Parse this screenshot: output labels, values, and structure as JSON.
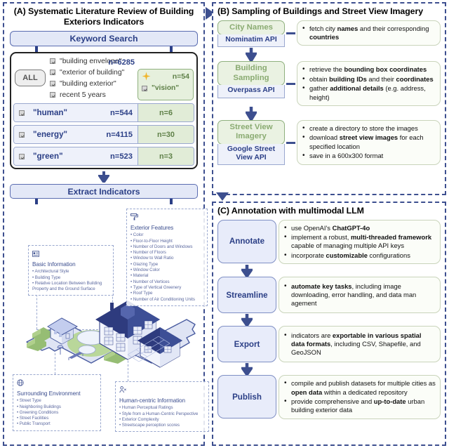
{
  "panels": {
    "a": {
      "title": "(A) Systematic Literature Review of Building Exteriors Indicators",
      "keyword_search_label": "Keyword Search",
      "all_button": "ALL",
      "all_terms": [
        "\"building envelope\"",
        "\"exterior of building\"",
        "\"building exterior\"",
        "recent 5 years"
      ],
      "all_n": "n=6285",
      "vision": {
        "n": "n=54",
        "term": "\"vision\"",
        "icon": "sparkle-star-icon"
      },
      "rows": [
        {
          "term": "\"human\"",
          "n": "n=544",
          "vision_n": "n=6"
        },
        {
          "term": "\"energy\"",
          "n": "n=4115",
          "vision_n": "n=30"
        },
        {
          "term": "\"green\"",
          "n": "n=523",
          "vision_n": "n=3"
        }
      ],
      "extract_label": "Extract Indicators",
      "indicator_groups": [
        {
          "title": "Basic Information",
          "icon": "id-card-icon",
          "items": [
            "Architectural Style",
            "Building Type",
            "Relative Location Between Building",
            "Property and the Ground Surface"
          ]
        },
        {
          "title": "Exterior Features",
          "icon": "paint-roller-icon",
          "items": [
            "Color",
            "Floor-to-Floor Height",
            "Number of Doors and Windows",
            "Number of Floors",
            "Window to Wall Ratio",
            "Glazing Type",
            "Window Color",
            "Material",
            "Number of Vertices",
            "Type of Vertical Greenery",
            "Roof Type",
            "Number of Air Conditioning Units"
          ]
        },
        {
          "title": "Surrounding Environment",
          "icon": "globe-icon",
          "items": [
            "Street Type",
            "Neighboring Buildings",
            "Greening Conditions",
            "Street Facilities",
            "Public Transport"
          ]
        },
        {
          "title": "Human-centric Information",
          "icon": "person-icon",
          "items": [
            "Human Perceptual Ratings",
            "Style from a Human-Centric Perspective",
            "Exterior Complexity",
            "Streetscape perception scores"
          ]
        }
      ],
      "illustration": "isometric-neighborhood-illustration"
    },
    "b": {
      "title": "(B) Sampling of Buildings and Street View Imagery",
      "steps": [
        {
          "name": "City Names",
          "api": "Nominatim API",
          "bullets": [
            [
              {
                "t": "fetch city "
              },
              {
                "t": "names",
                "b": true
              },
              {
                "t": " and their corresponding "
              },
              {
                "t": "countries",
                "b": true
              }
            ]
          ]
        },
        {
          "name": "Building Sampling",
          "api": "Overpass API",
          "bullets": [
            [
              {
                "t": "retrieve the "
              },
              {
                "t": "bounding box coordinates",
                "b": true
              }
            ],
            [
              {
                "t": "obtain "
              },
              {
                "t": "building IDs",
                "b": true
              },
              {
                "t": " and their "
              },
              {
                "t": "coordinates",
                "b": true
              }
            ],
            [
              {
                "t": "gather "
              },
              {
                "t": "additional details",
                "b": true
              },
              {
                "t": " (e.g. address, height)"
              }
            ]
          ]
        },
        {
          "name": "Street View Imagery",
          "api": "Google Street View API",
          "bullets": [
            [
              {
                "t": "create a directory to store the images"
              }
            ],
            [
              {
                "t": "download "
              },
              {
                "t": "street view  images",
                "b": true
              },
              {
                "t": " for each specified location"
              }
            ],
            [
              {
                "t": "save in a 600x300 format"
              }
            ]
          ]
        }
      ]
    },
    "c": {
      "title": "(C) Annotation with multimodal LLM",
      "steps": [
        {
          "name": "Annotate",
          "bullets": [
            [
              {
                "t": "use OpenAI's "
              },
              {
                "t": "ChatGPT-4o",
                "b": true
              }
            ],
            [
              {
                "t": "implement a robust, "
              },
              {
                "t": "multi-threaded framework",
                "b": true
              },
              {
                "t": " capable of managing multiple API keys"
              }
            ],
            [
              {
                "t": " incorporate "
              },
              {
                "t": "customizable",
                "b": true
              },
              {
                "t": " configurations"
              }
            ]
          ]
        },
        {
          "name": "Streamline",
          "bullets": [
            [
              {
                "t": "automate key tasks",
                "b": true
              },
              {
                "t": ", including image downloading, error handling, and data man agement"
              }
            ]
          ]
        },
        {
          "name": "Export",
          "bullets": [
            [
              {
                "t": "indicators are "
              },
              {
                "t": "exportable in various spatial data formats",
                "b": true
              },
              {
                "t": ", including CSV, Shapefile, and GeoJSON"
              }
            ]
          ]
        },
        {
          "name": "Publish",
          "bullets": [
            [
              {
                "t": "compile and publish datasets for multiple cities as "
              },
              {
                "t": "open data",
                "b": true
              },
              {
                "t": " within a dedicated repository"
              }
            ],
            [
              {
                "t": "provide comprehensive and "
              },
              {
                "t": "up-to-date",
                "b": true
              },
              {
                "t": " urban building exterior data"
              }
            ]
          ]
        }
      ]
    }
  },
  "colors": {
    "panel_border": "#3d4f8f",
    "blue_text": "#2b3f86",
    "blue_fill": "#e3e8f7",
    "green_text": "#8aab72",
    "green_fill": "#eaf2e2",
    "card_green_border": "#c9d4bb",
    "star_gold": "#f0b429"
  }
}
